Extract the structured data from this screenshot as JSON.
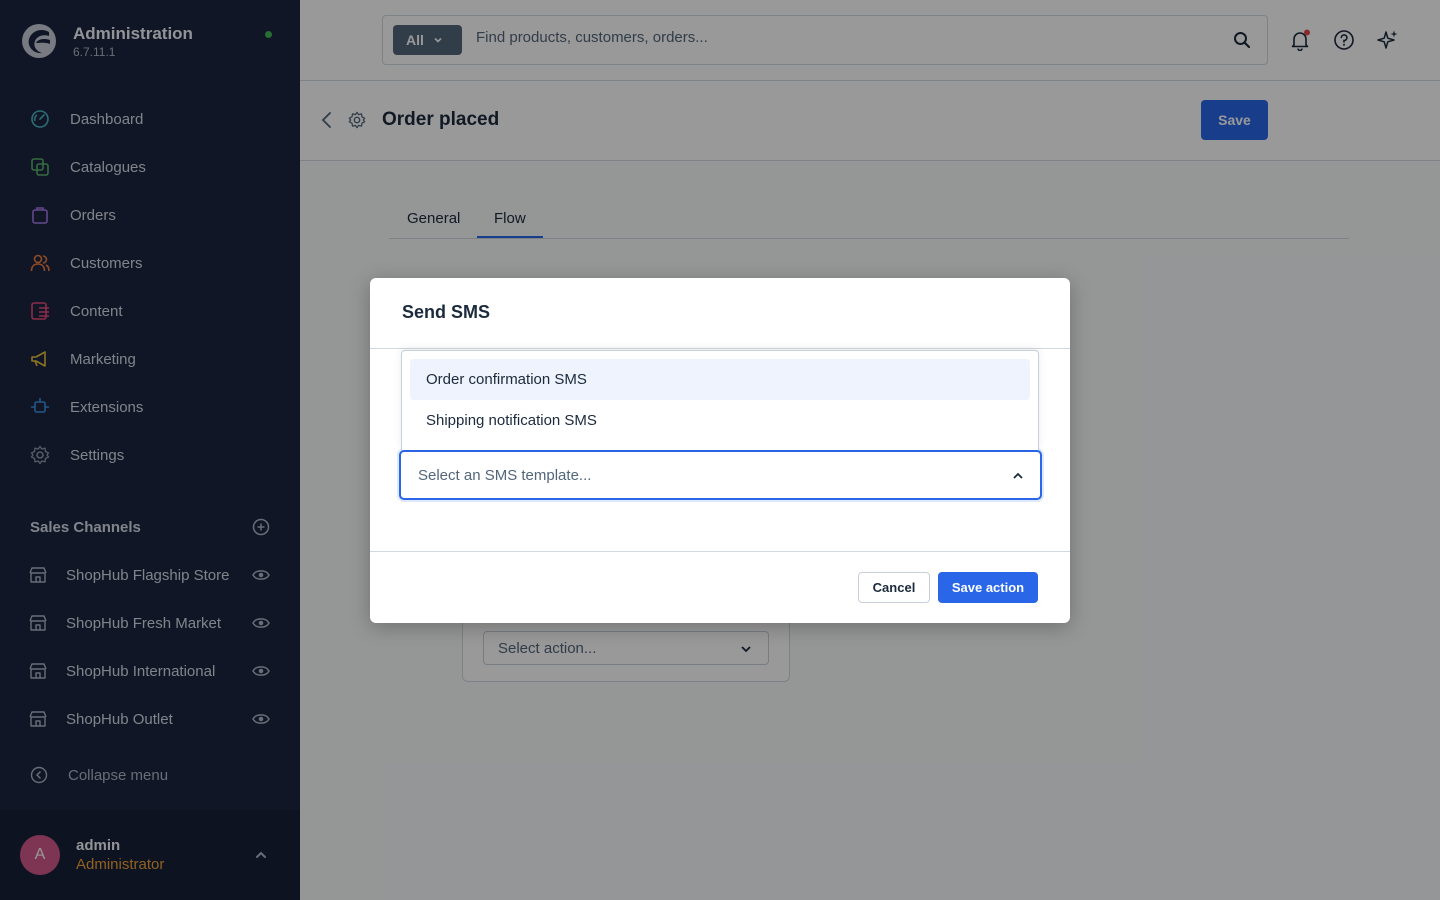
{
  "brand": {
    "title": "Administration",
    "version": "6.7.11.1"
  },
  "sidebar": {
    "items": [
      {
        "label": "Dashboard",
        "icon": "dashboard-icon",
        "color": "#4bb8c4"
      },
      {
        "label": "Catalogues",
        "icon": "catalogues-icon",
        "color": "#57b26d"
      },
      {
        "label": "Orders",
        "icon": "orders-icon",
        "color": "#a678e8"
      },
      {
        "label": "Customers",
        "icon": "customers-icon",
        "color": "#f07d3e"
      },
      {
        "label": "Content",
        "icon": "content-icon",
        "color": "#e84c7b"
      },
      {
        "label": "Marketing",
        "icon": "marketing-icon",
        "color": "#e8c13b"
      },
      {
        "label": "Extensions",
        "icon": "extensions-icon",
        "color": "#3a8fe0"
      },
      {
        "label": "Settings",
        "icon": "settings-icon",
        "color": "#8a98ab"
      }
    ],
    "sales_channels_title": "Sales Channels",
    "sales_channels": [
      {
        "label": "ShopHub Flagship Store"
      },
      {
        "label": "ShopHub Fresh Market"
      },
      {
        "label": "ShopHub International"
      },
      {
        "label": "ShopHub Outlet"
      }
    ],
    "collapse_label": "Collapse menu"
  },
  "user": {
    "initial": "A",
    "name": "admin",
    "role": "Administrator"
  },
  "search": {
    "type_label": "All",
    "placeholder": "Find products, customers, orders..."
  },
  "page": {
    "title": "Order placed",
    "save_label": "Save",
    "tabs": [
      {
        "label": "General"
      },
      {
        "label": "Flow"
      }
    ],
    "flow_select_placeholder": "Select action..."
  },
  "modal": {
    "title": "Send SMS",
    "select_placeholder": "Select an SMS template...",
    "options": [
      {
        "label": "Order confirmation SMS"
      },
      {
        "label": "Shipping notification SMS"
      }
    ],
    "cancel_label": "Cancel",
    "save_label": "Save action"
  },
  "colors": {
    "sidebar_bg": "#1c2640",
    "accent": "#2966e8",
    "role": "#f0a238",
    "avatar": "#d2578a",
    "notification_dot": "#e5484d",
    "status_dot": "#3fb950"
  }
}
